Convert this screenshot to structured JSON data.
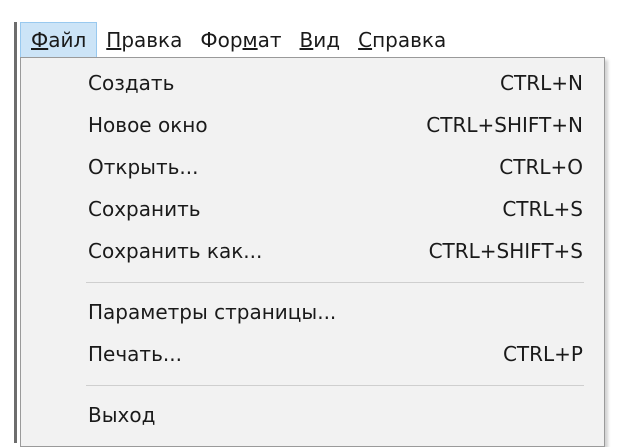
{
  "menubar": {
    "items": [
      {
        "label": "Файл",
        "active": true
      },
      {
        "label": "Правка",
        "active": false
      },
      {
        "label": "Формат",
        "active": false
      },
      {
        "label": "Вид",
        "active": false
      },
      {
        "label": "Справка",
        "active": false
      }
    ]
  },
  "file_menu": {
    "group1": [
      {
        "label": "Создать",
        "shortcut": "CTRL+N"
      },
      {
        "label": "Новое окно",
        "shortcut": "CTRL+SHIFT+N"
      },
      {
        "label": "Открыть...",
        "shortcut": "CTRL+O"
      },
      {
        "label": "Сохранить",
        "shortcut": "CTRL+S"
      },
      {
        "label": "Сохранить как...",
        "shortcut": "CTRL+SHIFT+S"
      }
    ],
    "group2": [
      {
        "label": "Параметры страницы...",
        "shortcut": ""
      },
      {
        "label": "Печать...",
        "shortcut": "CTRL+P"
      }
    ],
    "group3": [
      {
        "label": "Выход",
        "shortcut": ""
      }
    ]
  },
  "colors": {
    "menubar_active_bg": "#cce4f7",
    "menubar_active_border": "#99c9ef",
    "menu_bg": "#f2f2f2",
    "menu_border": "#9a9a9a",
    "separator": "#cfcfcf"
  }
}
